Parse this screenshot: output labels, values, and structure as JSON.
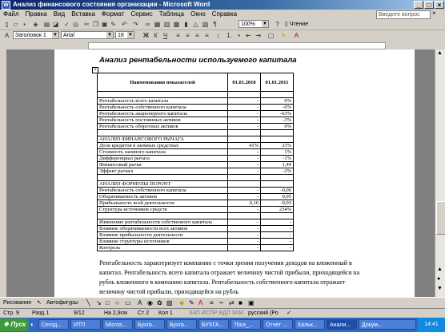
{
  "window": {
    "title": "Анализ финансового состояния организации - Microsoft Word"
  },
  "menu": {
    "items": [
      "Файл",
      "Правка",
      "Вид",
      "Вставка",
      "Формат",
      "Сервис",
      "Таблица",
      "Окно",
      "Справка"
    ],
    "help_placeholder": "Введите вопрос"
  },
  "toolbar": {
    "zoom": "100%",
    "reading": "Чтение",
    "style": "Заголовок 1",
    "font": "Arial",
    "size": "18"
  },
  "document": {
    "title": "Анализ рентабельности используемого капитала",
    "table": {
      "headers": [
        "Наименования показателей",
        "01.01.2010",
        "01.01.2011"
      ],
      "rows": [
        [
          "",
          "",
          ""
        ],
        [
          "Рентабельность всего капитала",
          "-",
          "0%"
        ],
        [
          "Рентабельность собственного капитала",
          "-",
          "-6%"
        ],
        [
          "Рентабельность акционерного капитала",
          "-",
          "-63%"
        ],
        [
          "Рентабельность постоянных активов",
          "-",
          "-3%"
        ],
        [
          "Рентабельность оборотных активов",
          "-",
          "0%"
        ],
        [
          "",
          "",
          ""
        ],
        [
          "АНАЛИЗ ФИНАНСОВОГО РЫЧАГА",
          "",
          ""
        ],
        [
          "Доля кредитов в заемных средствах",
          "41%",
          "33%"
        ],
        [
          "Стоимость заемного капитала",
          "-",
          "1%"
        ],
        [
          "Дифференциал рычага",
          "-",
          "-1%"
        ],
        [
          "Финансовый рычаг",
          "-",
          "1,44"
        ],
        [
          "Эффект рычага",
          "-",
          "-2%"
        ],
        [
          "",
          "",
          ""
        ],
        [
          "АНАЛИЗ ФОРМУЛЫ DUPONT",
          "",
          ""
        ],
        [
          "Рентабельность собственного капитала",
          "-",
          "-0,06"
        ],
        [
          "Оборачиваемость активов",
          "-",
          "0,95"
        ],
        [
          "Прибыльность всей деятельности",
          "0,16",
          "-0,03"
        ],
        [
          "Структура источников средств",
          "-",
          "234%"
        ],
        [
          "",
          "",
          ""
        ],
        [
          "Изменение рентабельности собственного капитала",
          "-",
          "-"
        ],
        [
          "Влияние оборачиваемости всех активов",
          "-",
          "-"
        ],
        [
          "Влияние прибыльности деятельности",
          "-",
          "-"
        ],
        [
          "Влияние структуры источников",
          "-",
          "-"
        ],
        [
          "Контроль",
          "-",
          "-"
        ]
      ]
    },
    "paragraph": "Рентабельность характеризует компанию с точки зрения получения доходов на вложенный в капитал. Рентабельность всего капитала отражает величину чистой прибыли, приходящейся на рубль вложенного в компанию капитала. Рентабельность собственного капитала отражает величину чистой прибыли, приходящейся на рубль"
  },
  "drawing_toolbar": {
    "draw": "Рисование",
    "autoshapes": "Автофигуры"
  },
  "status": {
    "page": "Стр. 9",
    "section": "Разд 1",
    "pages": "9/12",
    "position": "На 2,9см",
    "line": "Ст 2",
    "col": "Кол 1",
    "modes": "ЗАП  ИСПР  ВДЛ  ЗАМ",
    "lang": "русский (Ро"
  },
  "taskbar": {
    "start": "Пуск",
    "tasks": [
      "Сегод...",
      "ИТП",
      "Micros...",
      "Бухга...",
      "Бухга...",
      "БУХГА...",
      "7bux_...",
      "Отчет ...",
      "Кальк...",
      "Анали...",
      "Докум..."
    ],
    "clock": "14:41"
  }
}
